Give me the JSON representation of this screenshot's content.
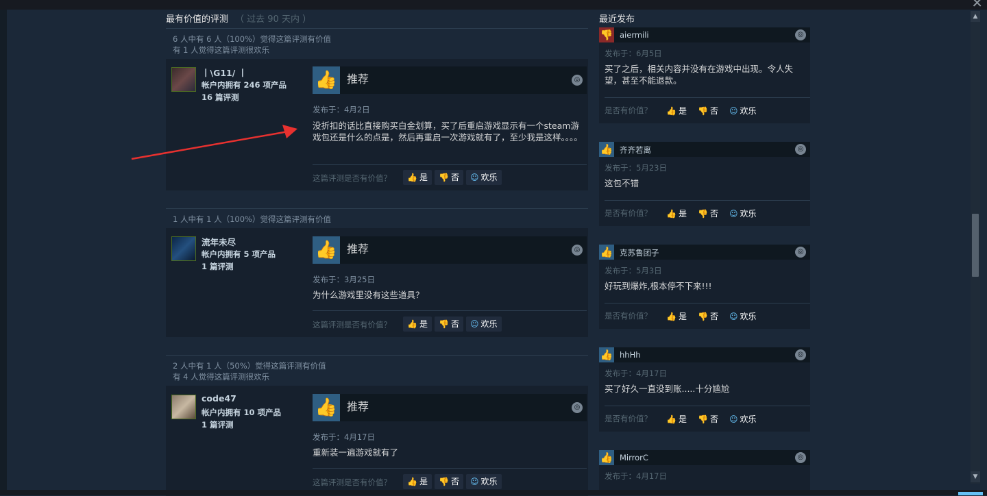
{
  "most_helpful": {
    "title": "最有价值的评测",
    "period": "（ 过去 90 天内 ）",
    "reviews": [
      {
        "summary_line1": "6 人中有 6 人（100%）觉得这篇评测有价值",
        "summary_line2": "有 1 人觉得这篇评测很欢乐",
        "author": "丨\\G11/ 丨",
        "owned": "帐户内拥有 246 项产品",
        "review_count": "16 篇评测",
        "verdict": "推荐",
        "posted": "发布于：4月2日",
        "content": "没折扣的话比直接购买白金划算，买了后重启游戏显示有一个steam游戏包还是什么的点是，然后再重启一次游戏就有了，至少我是这样。。。。",
        "helpful_question": "这篇评测是否有价值？",
        "yes": "是",
        "no": "否",
        "funny": "欢乐"
      },
      {
        "summary_line1": "1 人中有 1 人（100%）觉得这篇评测有价值",
        "summary_line2": "",
        "author": "流年未尽",
        "owned": "帐户内拥有 5 项产品",
        "review_count": "1 篇评测",
        "verdict": "推荐",
        "posted": "发布于：3月25日",
        "content": "为什么游戏里没有这些道具？",
        "helpful_question": "这篇评测是否有价值？",
        "yes": "是",
        "no": "否",
        "funny": "欢乐"
      },
      {
        "summary_line1": "2 人中有 1 人（50%）觉得这篇评测有价值",
        "summary_line2": "有 4 人觉得这篇评测很欢乐",
        "author": "code47",
        "owned": "帐户内拥有 10 项产品",
        "review_count": "1 篇评测",
        "verdict": "推荐",
        "posted": "发布于：4月17日",
        "content": "重新装一遍游戏就有了",
        "helpful_question": "这篇评测是否有价值？",
        "yes": "是",
        "no": "否",
        "funny": "欢乐"
      }
    ]
  },
  "recent": {
    "title": "最近发布",
    "reviews": [
      {
        "name": "aiermili",
        "recommended": false,
        "posted": "发布于：6月5日",
        "content": "买了之后，相关内容并没有在游戏中出现。令人失望，甚至不能退款。",
        "helpful_question": "是否有价值？",
        "yes": "是",
        "no": "否",
        "funny": "欢乐"
      },
      {
        "name": "齐齐若离",
        "recommended": true,
        "posted": "发布于：5月23日",
        "content": "这包不错",
        "helpful_question": "是否有价值？",
        "yes": "是",
        "no": "否",
        "funny": "欢乐"
      },
      {
        "name": "克苏鲁团子",
        "recommended": true,
        "posted": "发布于：5月3日",
        "content": "好玩到爆炸,根本停不下来!!!",
        "helpful_question": "是否有价值？",
        "yes": "是",
        "no": "否",
        "funny": "欢乐"
      },
      {
        "name": "hhHh",
        "recommended": true,
        "posted": "发布于：4月17日",
        "content": "买了好久一直没到账.....十分尴尬",
        "helpful_question": "是否有价值？",
        "yes": "是",
        "no": "否",
        "funny": "欢乐"
      },
      {
        "name": "MirrorC",
        "recommended": true,
        "posted": "发布于：4月17日",
        "content": "",
        "helpful_question": "是否有价值？",
        "yes": "是",
        "no": "否",
        "funny": "欢乐"
      }
    ]
  },
  "icons": {
    "thumbs_up": "👍",
    "thumbs_down": "👎",
    "funny": "☺",
    "steam": "◎",
    "close": "✕"
  },
  "colors": {
    "background": "#1b2838",
    "accent": "#66c0f4",
    "negative": "#8a2929"
  }
}
